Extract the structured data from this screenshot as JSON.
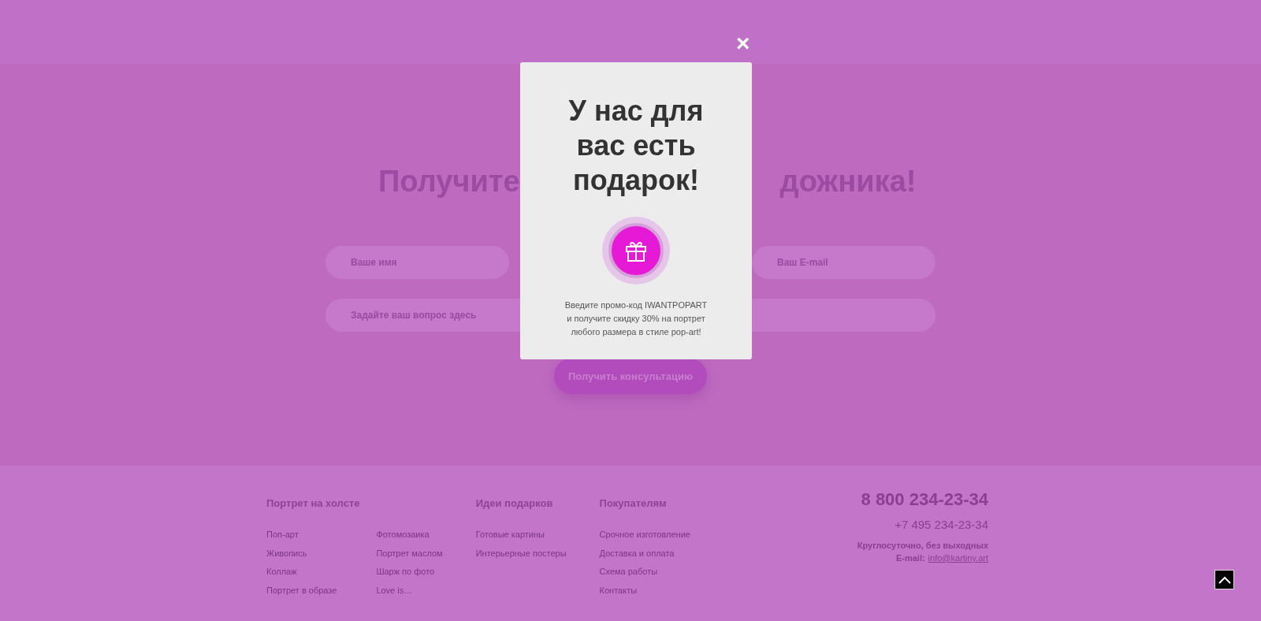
{
  "form": {
    "heading_parts": [
      "Получите",
      "дожника!"
    ],
    "fields": [
      {
        "kind": "short",
        "placeholder": "Ваше имя"
      },
      {
        "kind": "short",
        "placeholder": "Ваш E-mail"
      },
      {
        "kind": "long",
        "placeholder": "Задайте ваш вопрос здесь"
      },
      {
        "kind": "long"
      }
    ],
    "button": "Получить консультацию"
  },
  "footer": {
    "columns": [
      {
        "kind": "double",
        "title": "Портрет на холсте",
        "links": [
          "Поп-арт",
          "Живопись",
          "Коллаж",
          "Портрет в образе",
          "Фотомозаика",
          "Портрет маслом",
          "Шарж по фото",
          "Love is…"
        ]
      },
      {
        "kind": "single",
        "title": "Идеи подарков",
        "links": [
          "Готовые картины",
          "Интерьерные постеры"
        ]
      },
      {
        "kind": "single",
        "title": "Покупателям",
        "links": [
          "Срочное изготовление",
          "Доставка и оплата",
          "Схема работы",
          "Контакты"
        ]
      }
    ],
    "contacts": {
      "phone": "8 800 234-23-34",
      "phone_2": "+7 495 234-23-34",
      "hours": "Круглосуточно, без выходных",
      "email_label": "E-mail:",
      "email": "info@kartiny.art"
    }
  },
  "popup": {
    "close": "×",
    "title": "У нас для вас есть подарок!",
    "text_lines": [
      "Введите промо-код IWANTPOPART",
      "и получите скидку 30% на портрет",
      "любого размера в стиле pop-art!"
    ]
  }
}
